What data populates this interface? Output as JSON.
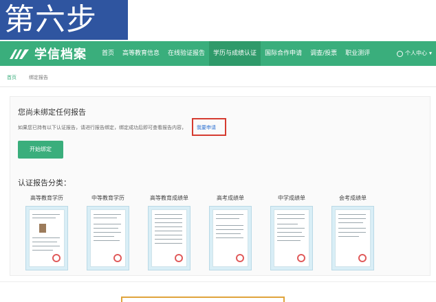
{
  "step": {
    "label": "第六步"
  },
  "header": {
    "brand": "学信档案",
    "nav": [
      {
        "label": "首页",
        "active": false
      },
      {
        "label": "高等教育信息",
        "active": false
      },
      {
        "label": "在线验证报告",
        "active": false
      },
      {
        "label": "学历与成绩认证",
        "active": true
      },
      {
        "label": "国际合作申请",
        "active": false
      },
      {
        "label": "调查/投票",
        "active": false
      },
      {
        "label": "职业测评",
        "active": false
      }
    ],
    "user_center": "个人中心"
  },
  "breadcrumb": {
    "home": "首页",
    "current": "绑定报告"
  },
  "main": {
    "none_title": "您尚未绑定任何报告",
    "hint": "如果您已持有以下认证报告，请进行报告绑定，绑定成功后即可查看报告内容，",
    "apply_link": "我要申请",
    "start_button": "开始绑定",
    "category_title": "认证报告分类："
  },
  "categories": [
    {
      "label": "高等教育学历"
    },
    {
      "label": "中等教育学历"
    },
    {
      "label": "高等教育成绩单"
    },
    {
      "label": "高考成绩单"
    },
    {
      "label": "中学成绩单"
    },
    {
      "label": "会考成绩单"
    }
  ],
  "colors": {
    "brand_green": "#3aae7c",
    "step_blue": "#2f55a0",
    "highlight_red": "#d53a2f",
    "link_blue": "#2a6fd1"
  }
}
